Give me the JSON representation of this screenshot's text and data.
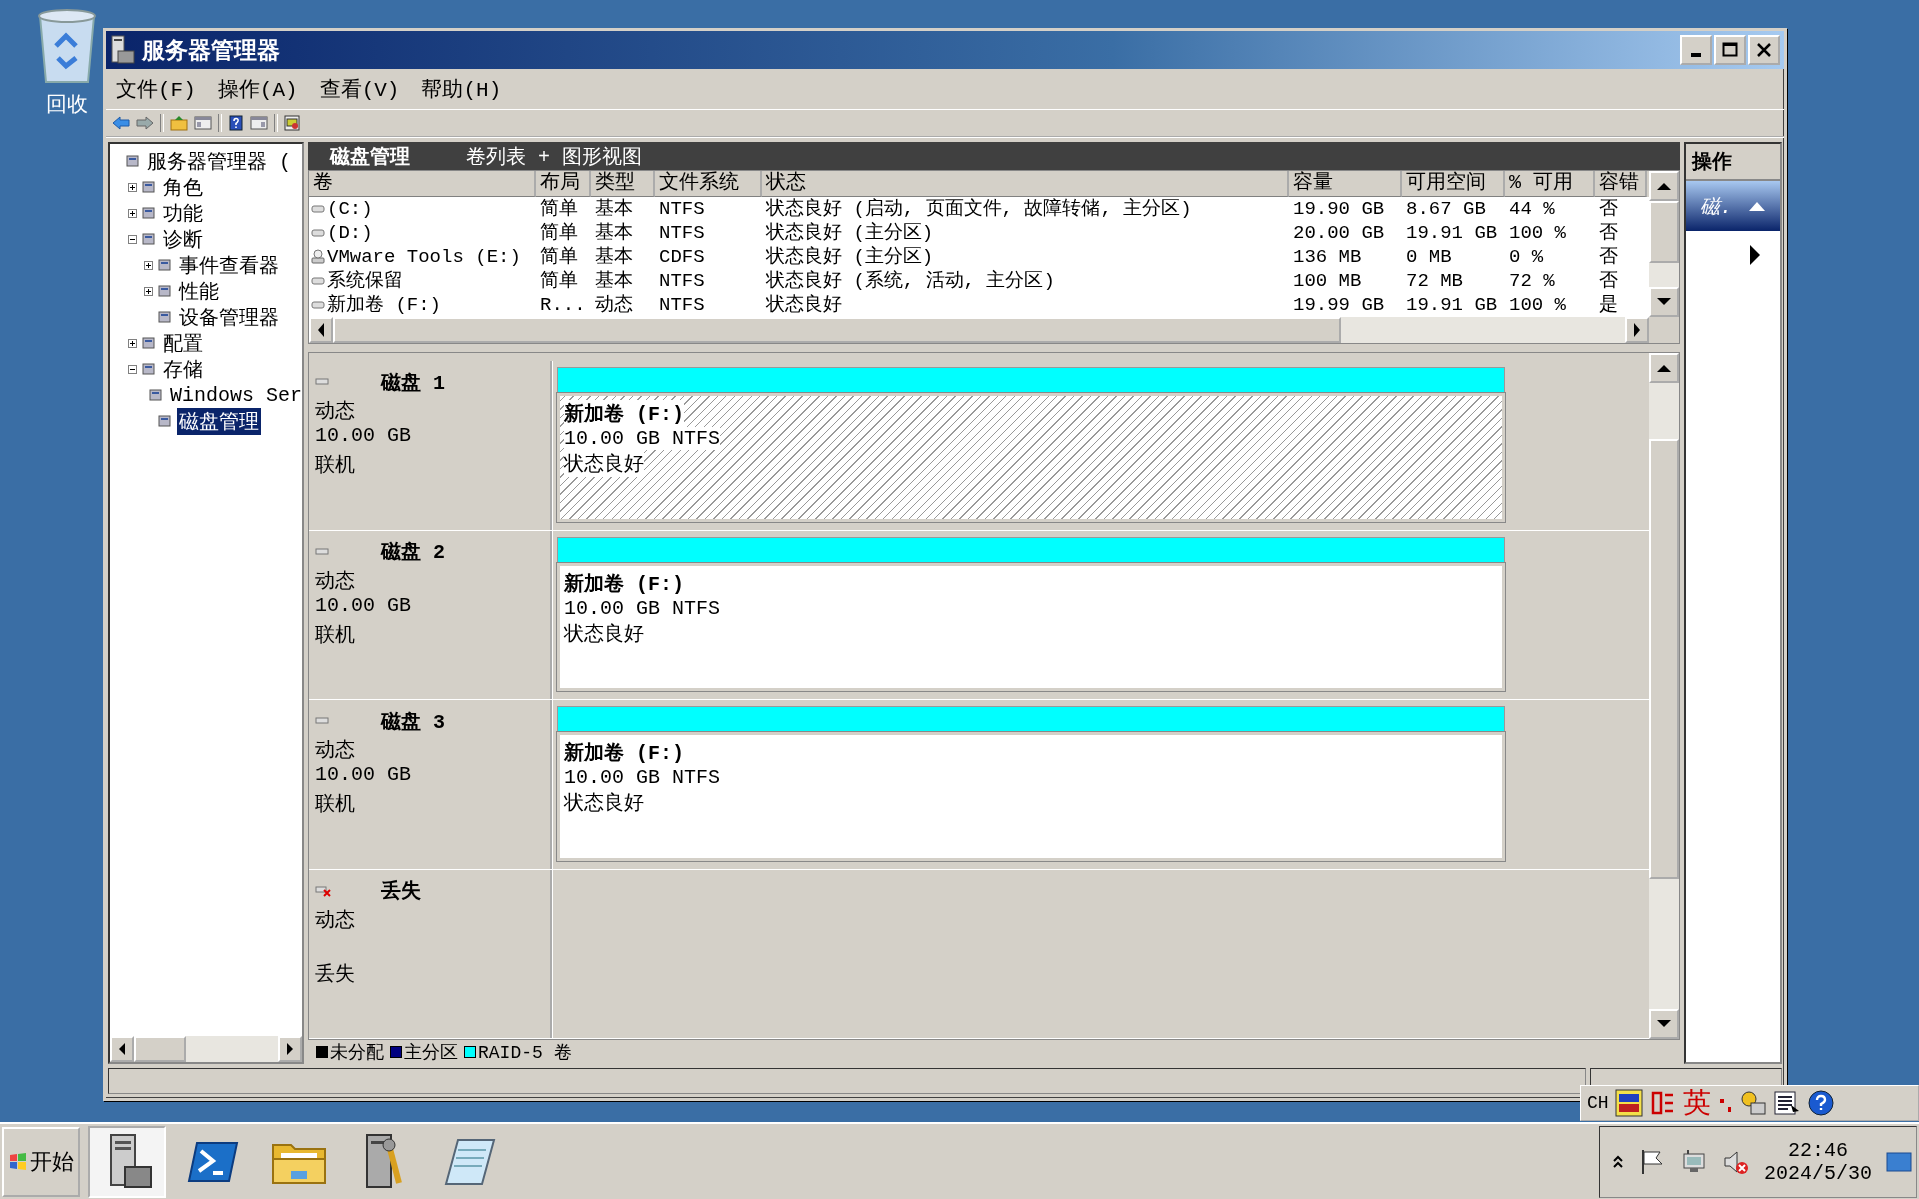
{
  "desktop": {
    "icons": [
      {
        "label": "回收"
      }
    ]
  },
  "window": {
    "title": "服务器管理器"
  },
  "menu": [
    "文件(F)",
    "操作(A)",
    "查看(V)",
    "帮助(H)"
  ],
  "tree": [
    {
      "label": "服务器管理器 (",
      "selected": false,
      "children": [
        {
          "label": "角色",
          "expanded": false,
          "selected": false
        },
        {
          "label": "功能",
          "expanded": false,
          "selected": false
        },
        {
          "label": "诊断",
          "expanded": true,
          "selected": false,
          "children": [
            {
              "label": "事件查看器",
              "expanded": false,
              "selected": false
            },
            {
              "label": "性能",
              "expanded": false,
              "selected": false
            },
            {
              "label": "设备管理器",
              "selected": false
            }
          ]
        },
        {
          "label": "配置",
          "expanded": false,
          "selected": false
        },
        {
          "label": "存储",
          "expanded": true,
          "selected": false,
          "children": [
            {
              "label": "Windows Ser",
              "selected": false
            },
            {
              "label": "磁盘管理",
              "selected": true
            }
          ]
        }
      ]
    }
  ],
  "pane": {
    "title": "磁盘管理",
    "view": "卷列表 + 图形视图"
  },
  "volumes": {
    "columns": [
      "卷",
      "布局",
      "类型",
      "文件系统",
      "状态",
      "容量",
      "可用空间",
      "% 可用",
      "容错"
    ],
    "rows": [
      {
        "kind": "disk",
        "cells": [
          " (C:)",
          "简单",
          "基本",
          "NTFS",
          "状态良好 (启动, 页面文件, 故障转储, 主分区)",
          "19.90 GB",
          "8.67 GB",
          "44 %",
          "否"
        ]
      },
      {
        "kind": "disk",
        "cells": [
          " (D:)",
          "简单",
          "基本",
          "NTFS",
          "状态良好 (主分区)",
          "20.00 GB",
          "19.91 GB",
          "100 %",
          "否"
        ]
      },
      {
        "kind": "cd",
        "cells": [
          "VMware Tools (E:)",
          "简单",
          "基本",
          "CDFS",
          "状态良好 (主分区)",
          "136 MB",
          "0 MB",
          "0 %",
          "否"
        ]
      },
      {
        "kind": "disk",
        "cells": [
          "系统保留",
          "简单",
          "基本",
          "NTFS",
          "状态良好 (系统, 活动, 主分区)",
          "100 MB",
          "72 MB",
          "72 %",
          "否"
        ]
      },
      {
        "kind": "disk",
        "cells": [
          "新加卷 (F:)",
          "R...",
          "动态",
          "NTFS",
          "状态良好",
          "19.99 GB",
          "19.91 GB",
          "100 %",
          "是"
        ]
      }
    ]
  },
  "disks": [
    {
      "kind": "online",
      "name": "磁盘 1",
      "type": "动态",
      "size": "10.00 GB",
      "status": "联机",
      "partition": {
        "label": "新加卷 (F:)",
        "size": "10.00 GB NTFS",
        "status": "状态良好",
        "selected": true
      }
    },
    {
      "kind": "online",
      "name": "磁盘 2",
      "type": "动态",
      "size": "10.00 GB",
      "status": "联机",
      "partition": {
        "label": "新加卷 (F:)",
        "size": "10.00 GB NTFS",
        "status": "状态良好",
        "selected": false
      }
    },
    {
      "kind": "online",
      "name": "磁盘 3",
      "type": "动态",
      "size": "10.00 GB",
      "status": "联机",
      "partition": {
        "label": "新加卷 (F:)",
        "size": "10.00 GB NTFS",
        "status": "状态良好",
        "selected": false
      }
    },
    {
      "kind": "missing",
      "name": "丢失",
      "type": "动态",
      "status": "丢失"
    }
  ],
  "legend": [
    {
      "label": "未分配",
      "color": "#000000"
    },
    {
      "label": "主分区",
      "color": "#000080"
    },
    {
      "label": "RAID-5 卷",
      "color": "#00ffff"
    }
  ],
  "actions": {
    "title": "操作",
    "items": [
      {
        "label": "磁.",
        "expanded": true
      }
    ]
  },
  "ime": {
    "language": "CH",
    "mode": "英"
  },
  "taskbar": {
    "start": "开始",
    "tasks": [
      {
        "selected": true
      },
      {
        "selected": false
      },
      {
        "selected": false
      },
      {
        "selected": false
      },
      {
        "selected": false
      }
    ],
    "clock": {
      "time": "22:46",
      "date": "2024/5/30"
    }
  }
}
